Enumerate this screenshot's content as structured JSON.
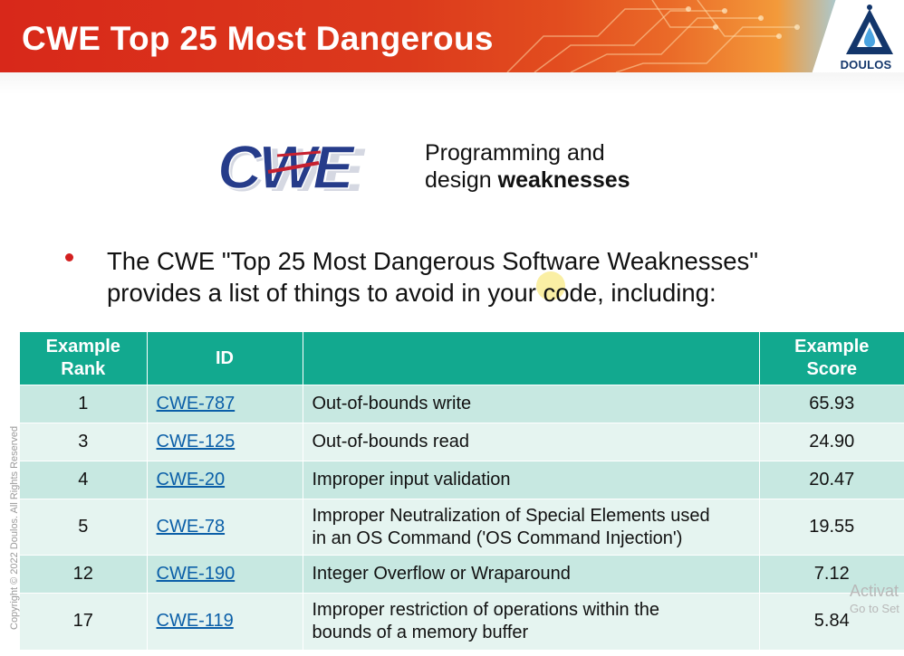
{
  "header": {
    "title": "CWE Top 25 Most Dangerous",
    "logo_text": "DOULOS"
  },
  "cwe_block": {
    "logo_text": "CWE",
    "subtitle_line1": "Programming and",
    "subtitle_line2_prefix": "design ",
    "subtitle_line2_bold": "weaknesses"
  },
  "bullet": {
    "line1": "The CWE \"Top 25 Most Dangerous Software Weaknesses\"",
    "line2": "provides a list of things to avoid in your code, including:"
  },
  "table": {
    "headers": {
      "rank_line1": "Example",
      "rank_line2": "Rank",
      "id": "ID",
      "description": "",
      "score_line1": "Example",
      "score_line2": "Score"
    },
    "rows": [
      {
        "rank": "1",
        "id": "CWE-787",
        "description_line1": "Out-of-bounds write",
        "description_line2": "",
        "score": "65.93"
      },
      {
        "rank": "3",
        "id": "CWE-125",
        "description_line1": "Out-of-bounds read",
        "description_line2": "",
        "score": "24.90"
      },
      {
        "rank": "4",
        "id": "CWE-20",
        "description_line1": "Improper input validation",
        "description_line2": "",
        "score": "20.47"
      },
      {
        "rank": "5",
        "id": "CWE-78",
        "description_line1": "Improper Neutralization of Special Elements used",
        "description_line2": "in an OS Command ('OS Command Injection')",
        "score": "19.55"
      },
      {
        "rank": "12",
        "id": "CWE-190",
        "description_line1": "Integer Overflow or Wraparound",
        "description_line2": "",
        "score": "7.12"
      },
      {
        "rank": "17",
        "id": "CWE-119",
        "description_line1": "Improper restriction of operations within the",
        "description_line2": "bounds of a memory buffer",
        "score": "5.84"
      }
    ]
  },
  "footer": {
    "copyright": "Copyright © 2022 Doulos. All Rights Reserved",
    "watermark_line1": "Activat",
    "watermark_line2": "Go to Set"
  },
  "colors": {
    "header_red": "#d8281a",
    "table_header": "#12a98f",
    "row_odd": "#c7e8e1",
    "row_even": "#e5f4f0",
    "link": "#0b5fa8",
    "bullet": "#d32020",
    "logo_navy": "#13366b"
  }
}
